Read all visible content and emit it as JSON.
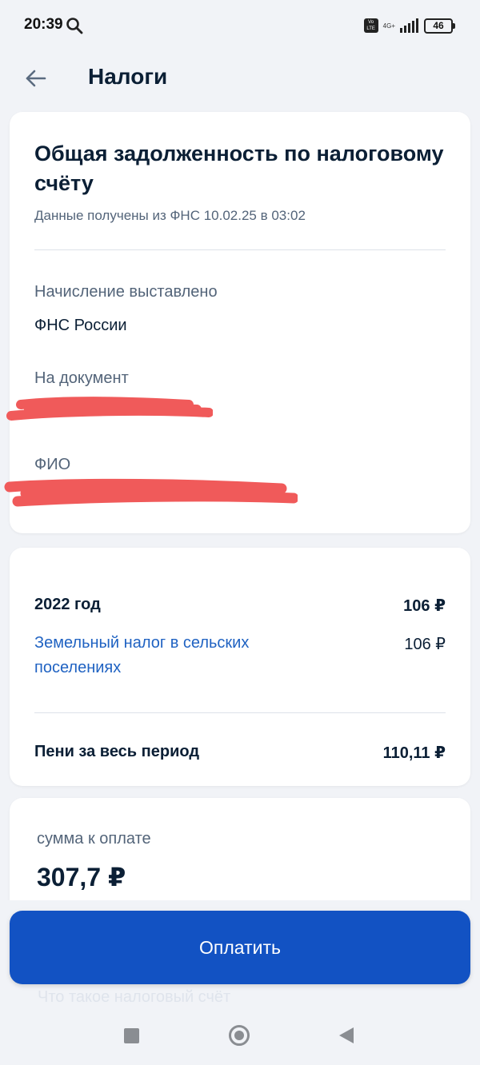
{
  "status_bar": {
    "time": "20:39",
    "network_badge": "Vo LTE",
    "network_type": "4G+",
    "battery": "46"
  },
  "header": {
    "title": "Налоги"
  },
  "debt_card": {
    "title": "Общая задолженность по налоговому счёту",
    "data_source": "Данные получены из ФНС 10.02.25 в 03:02",
    "accrual_label": "Начисление выставлено",
    "accrual_value": "ФНС России",
    "document_label": "На документ",
    "fio_label": "ФИО"
  },
  "breakdown_card": {
    "year_label": "2022 год",
    "year_amount": "106 ₽",
    "tax_name": "Земельный налог в сельских поселениях",
    "tax_amount": "106 ₽",
    "penalty_label": "Пени за весь период",
    "penalty_amount": "110,11 ₽"
  },
  "summary_card": {
    "sum_label": "сумма к оплате",
    "sum_value": "307,7 ₽"
  },
  "pay_button_label": "Оплатить",
  "tax_account_link": "Что такое налоговый счёт",
  "colors": {
    "primary": "#1252c3",
    "link": "#1f62c2",
    "background": "#f1f3f7",
    "redaction": "#f05a5a"
  },
  "icons": {
    "back": "arrow-left-icon",
    "search": "search-icon",
    "nav_recent": "square-icon",
    "nav_home": "circle-icon",
    "nav_back": "triangle-left-icon"
  }
}
